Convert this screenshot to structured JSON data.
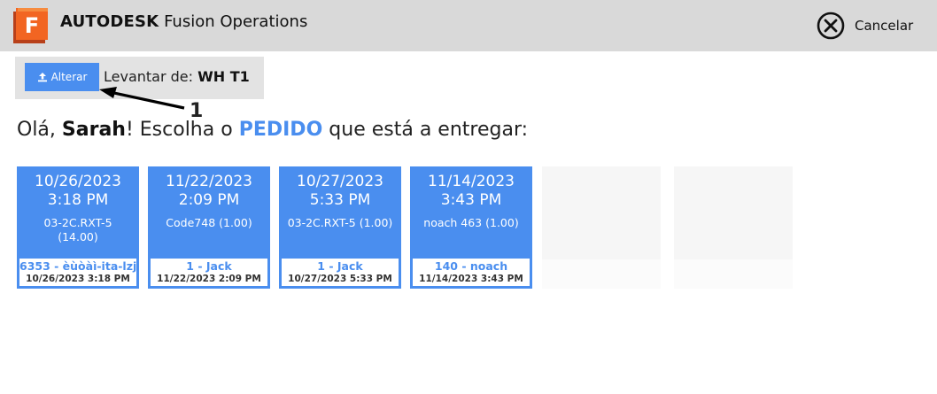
{
  "header": {
    "brand": "AUTODESK",
    "product": "Fusion Operations",
    "logo_letter": "F",
    "cancel_label": "Cancelar",
    "logo_icon": "fusion-logo-icon",
    "cancel_icon": "close-circle-icon"
  },
  "pickup": {
    "change_label": "Alterar",
    "change_icon": "upload-icon",
    "label": "Levantar de:",
    "location": "WH T1"
  },
  "annotation": {
    "number": "1"
  },
  "greeting": {
    "prefix": "Olá,",
    "name": "Sarah",
    "middle": "! Escolha o",
    "keyword": "PEDIDO",
    "suffix": "que está a entregar:"
  },
  "orders": [
    {
      "date": "10/26/2023",
      "time": "3:18 PM",
      "item": "03-2C.RXT-5 (14.00)",
      "ref": "6353 - èùòàì-ita-lzj",
      "stamp": "10/26/2023 3:18 PM"
    },
    {
      "date": "11/22/2023",
      "time": "2:09 PM",
      "item": "Code748 (1.00)",
      "ref": "1 - Jack",
      "stamp": "11/22/2023 2:09 PM"
    },
    {
      "date": "10/27/2023",
      "time": "5:33 PM",
      "item": "03-2C.RXT-5 (1.00)",
      "ref": "1 - Jack",
      "stamp": "10/27/2023 5:33 PM"
    },
    {
      "date": "11/14/2023",
      "time": "3:43 PM",
      "item": "noach 463 (1.00)",
      "ref": "140 - noach",
      "stamp": "11/14/2023 3:43 PM"
    }
  ],
  "colors": {
    "accent": "#4a8eef",
    "topbar": "#d9d9d9",
    "logo_orange": "#f26522"
  }
}
